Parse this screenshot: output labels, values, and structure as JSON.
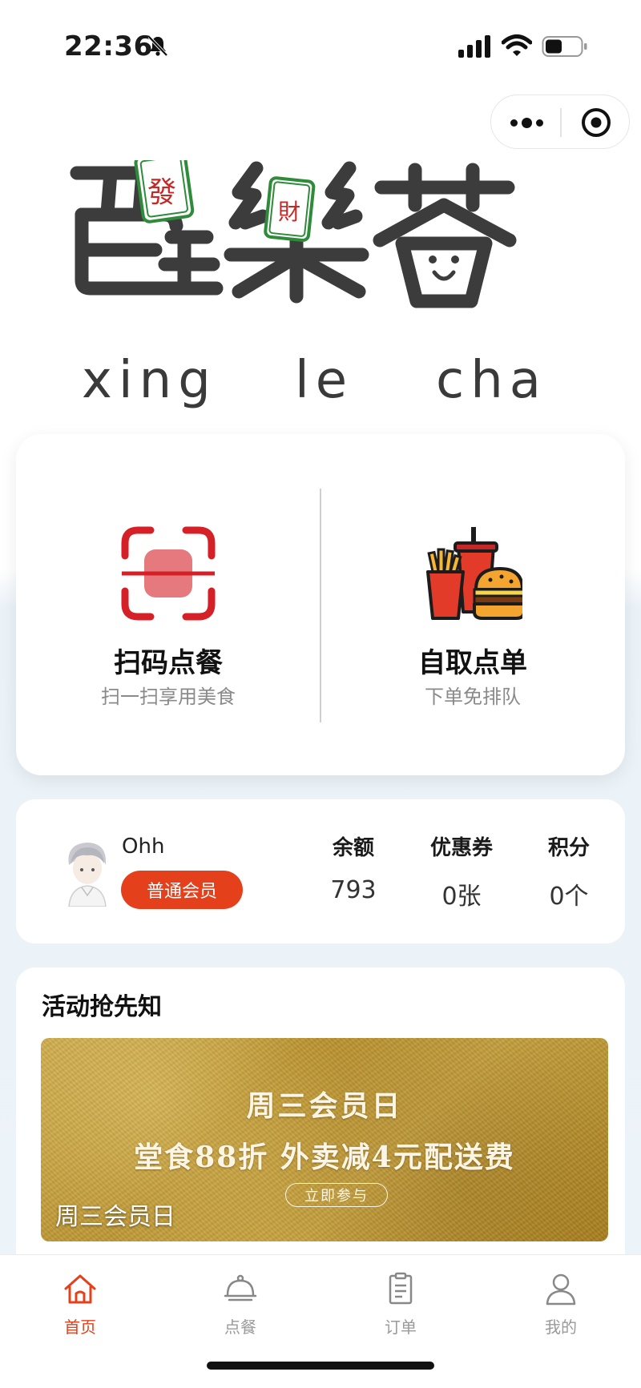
{
  "status_bar": {
    "time": "22:36",
    "icons": [
      "bell-slash-icon",
      "signal-icon",
      "wifi-icon",
      "battery-icon"
    ]
  },
  "capsule": {
    "icons": [
      "more-icon",
      "close-target-icon"
    ]
  },
  "logo": {
    "hanzi": [
      "醒",
      "樂",
      "茶"
    ],
    "tile_marks": [
      "發",
      "財"
    ],
    "latin": [
      "xing",
      "le",
      "cha"
    ]
  },
  "order_options": [
    {
      "title": "扫码点餐",
      "subtitle": "扫一扫享用美食",
      "icon": "scan-icon"
    },
    {
      "title": "自取点单",
      "subtitle": "下单免排队",
      "icon": "fast-food-icon"
    }
  ],
  "member": {
    "name": "Ohh",
    "level": "普通会员",
    "stats": [
      {
        "label": "余额",
        "value": "793"
      },
      {
        "label": "优惠券",
        "value": "0张"
      },
      {
        "label": "积分",
        "value": "0个"
      }
    ]
  },
  "activity": {
    "title": "活动抢先知",
    "banner": {
      "line1": "周三会员日",
      "line2": "堂食88折 外卖减4元配送费",
      "button": "立即参与",
      "caption": "周三会员日"
    }
  },
  "tabs": [
    {
      "label": "首页",
      "icon": "home-icon",
      "active": true
    },
    {
      "label": "点餐",
      "icon": "cloche-icon",
      "active": false
    },
    {
      "label": "订单",
      "icon": "order-list-icon",
      "active": false
    },
    {
      "label": "我的",
      "icon": "user-icon",
      "active": false
    }
  ],
  "colors": {
    "accent": "#e4401c",
    "scan_red": "#d42026",
    "tile_green": "#2e8b3a"
  }
}
